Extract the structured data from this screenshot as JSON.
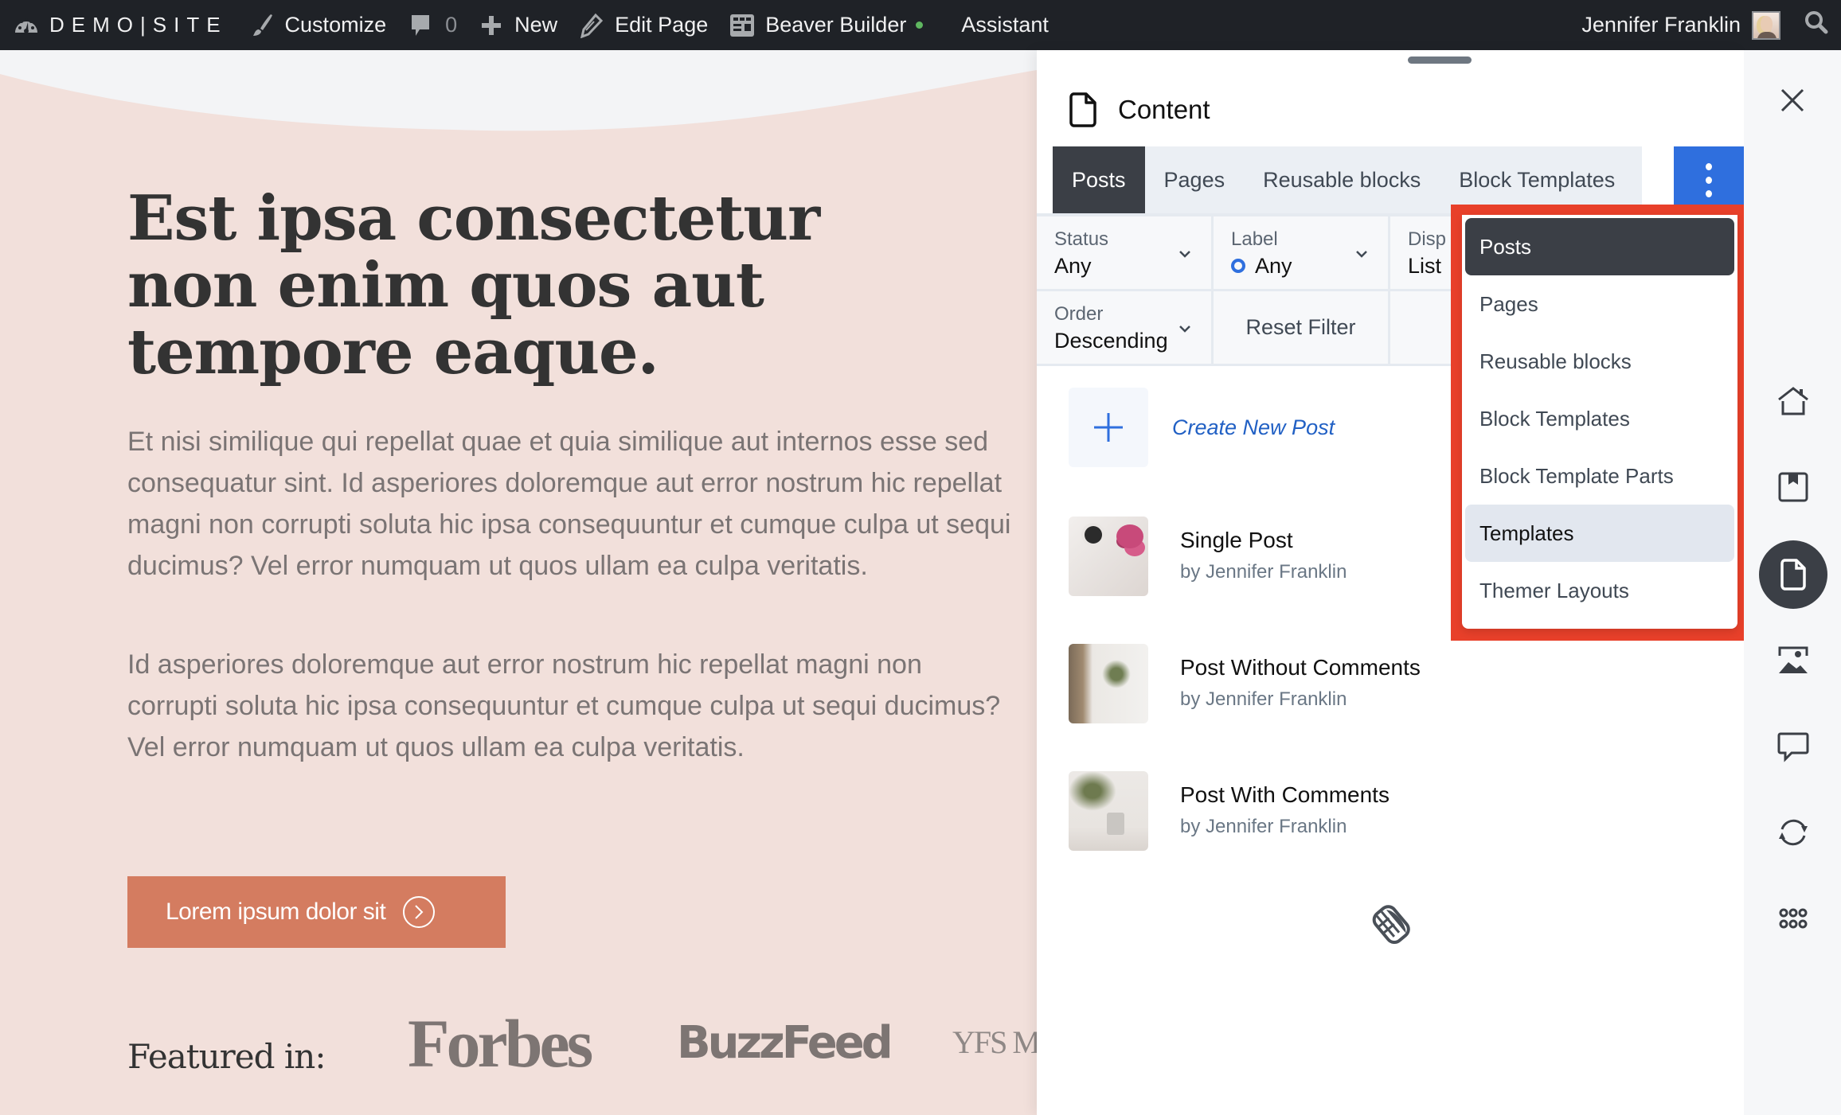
{
  "adminbar": {
    "site_name": "DEMO|SITE",
    "customize": "Customize",
    "comments_count": "0",
    "new": "New",
    "edit_page": "Edit Page",
    "beaver_builder": "Beaver Builder",
    "assistant": "Assistant",
    "user_name": "Jennifer Franklin",
    "status_dot_color": "#5fb760"
  },
  "page": {
    "hero_title": "Est ipsa consectetur non enim quos aut tempore eaque.",
    "paragraph_1": "Et nisi similique qui repellat quae et quia similique aut internos esse sed consequatur sint. Id asperiores doloremque aut error nostrum hic repellat magni non corrupti soluta hic ipsa consequuntur et cumque culpa ut sequi ducimus? Vel error numquam ut quos ullam ea culpa veritatis.",
    "paragraph_2": "Id asperiores doloremque aut error nostrum hic repellat magni non corrupti soluta hic ipsa consequuntur et cumque culpa ut sequi ducimus? Vel error numquam ut quos ullam ea culpa veritatis.",
    "cta_label": "Lorem ipsum dolor sit",
    "featured_label": "Featured in:",
    "logos": [
      "Forbes",
      "BuzzFeed",
      "YFS M"
    ],
    "accent_color": "#d47c60",
    "background_color": "#f2e0db"
  },
  "panel": {
    "title": "Content",
    "tabs": [
      {
        "label": "Posts",
        "active": true
      },
      {
        "label": "Pages",
        "active": false
      },
      {
        "label": "Reusable blocks",
        "active": false
      },
      {
        "label": "Block Templates",
        "active": false
      }
    ],
    "more_button_color": "#2f6fde",
    "filters": {
      "status": {
        "label": "Status",
        "value": "Any"
      },
      "label": {
        "label": "Label",
        "value": "Any"
      },
      "display": {
        "label": "Disp",
        "value": "List"
      },
      "order": {
        "label": "Order",
        "value": "Descending"
      },
      "reset": "Reset Filter"
    },
    "create_new": "Create New Post",
    "posts": [
      {
        "title": "Single Post",
        "author": "by Jennifer Franklin"
      },
      {
        "title": "Post Without Comments",
        "author": "by Jennifer Franklin"
      },
      {
        "title": "Post With Comments",
        "author": "by Jennifer Franklin"
      }
    ]
  },
  "dropdown": {
    "highlight_color": "#e8402a",
    "items": [
      {
        "label": "Posts",
        "state": "selected"
      },
      {
        "label": "Pages",
        "state": "normal"
      },
      {
        "label": "Reusable blocks",
        "state": "normal"
      },
      {
        "label": "Block Templates",
        "state": "normal"
      },
      {
        "label": "Block Template Parts",
        "state": "normal"
      },
      {
        "label": "Templates",
        "state": "hover"
      },
      {
        "label": "Themer Layouts",
        "state": "normal"
      }
    ]
  },
  "rail": {
    "items": [
      "home-icon",
      "saved-icon",
      "content-icon",
      "media-icon",
      "comments-icon",
      "revisions-icon",
      "apps-icon"
    ],
    "active": "content-icon"
  }
}
